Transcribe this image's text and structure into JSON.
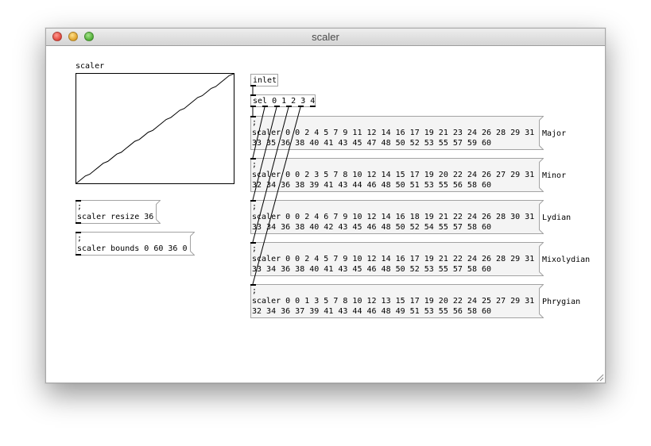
{
  "window": {
    "title": "scaler"
  },
  "graph": {
    "label": "scaler"
  },
  "objects": {
    "inlet": "inlet",
    "select": "sel 0 1 2 3 4"
  },
  "side_messages": [
    {
      "line1": ";",
      "line2": "scaler resize 36"
    },
    {
      "line1": ";",
      "line2": "scaler bounds 0 60 36 0"
    }
  ],
  "scale_messages": [
    {
      "line1": ";",
      "line2": "scaler 0 0 2 4 5 7 9 11 12 14 16 17 19 21 23 24 26 28 29 31",
      "line3": "33 35 36 38 40 41 43 45 47 48 50 52 53 55 57 59 60",
      "name": "Major"
    },
    {
      "line1": ";",
      "line2": "scaler 0 0 2 3 5 7 8 10 12 14 15 17 19 20 22 24 26 27 29 31",
      "line3": "32 34 36 38 39 41 43 44 46 48 50 51 53 55 56 58 60",
      "name": "Minor"
    },
    {
      "line1": ";",
      "line2": "scaler 0 0 2 4 6 7 9 10 12 14 16 18 19 21 22 24 26 28 30 31",
      "line3": "33 34 36 38 40 42 43 45 46 48 50 52 54 55 57 58 60",
      "name": "Lydian"
    },
    {
      "line1": ";",
      "line2": "scaler 0 0 2 4 5 7 9 10 12 14 16 17 19 21 22 24 26 28 29 31",
      "line3": "33 34 36 38 40 41 43 45 46 48 50 52 53 55 57 58 60",
      "name": "Mixolydian"
    },
    {
      "line1": ";",
      "line2": "scaler 0 0 1 3 5 7 8 10 12 13 15 17 19 20 22 24 25 27 29 31",
      "line3": "32 34 36 37 39 41 43 44 46 48 49 51 53 55 56 58 60",
      "name": "Phrygian"
    }
  ],
  "array_values": [
    0,
    2,
    4,
    5,
    7,
    9,
    11,
    12,
    14,
    16,
    17,
    19,
    21,
    23,
    24,
    26,
    28,
    29,
    31,
    33,
    35,
    36,
    38,
    40,
    41,
    43,
    45,
    47,
    48,
    50,
    52,
    53,
    55,
    57,
    59,
    60
  ]
}
